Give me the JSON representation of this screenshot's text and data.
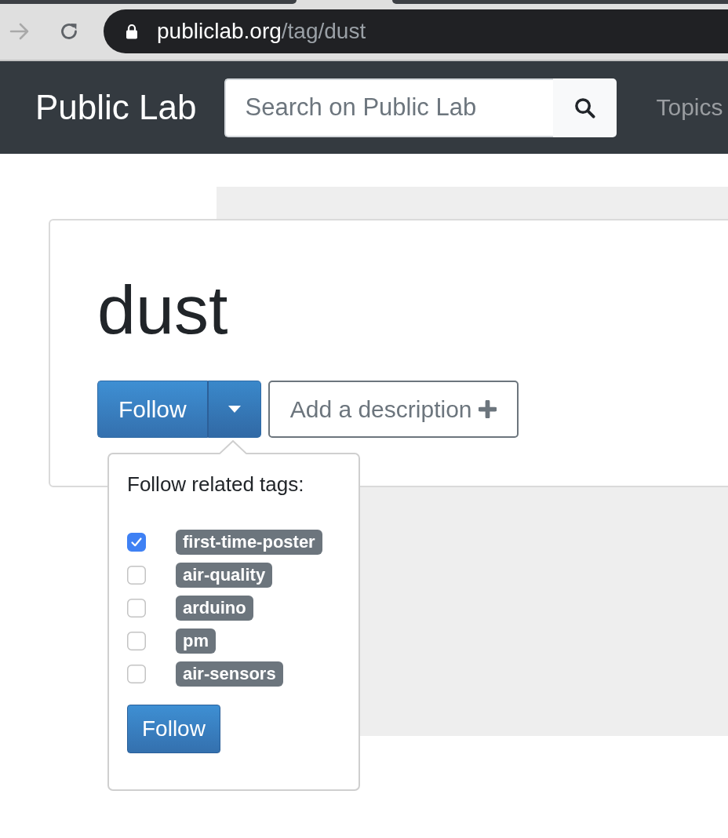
{
  "browser": {
    "url": {
      "host": "publiclab.org",
      "path": "/tag/dust"
    }
  },
  "navbar": {
    "brand": "Public Lab",
    "search": {
      "placeholder": "Search on Public Lab"
    },
    "links": [
      {
        "label": "Topics"
      }
    ]
  },
  "tag_header": {
    "title": "dust",
    "follow_button": {
      "label": "Follow",
      "expanded": true
    },
    "description_button": {
      "label": "Add a description"
    }
  },
  "follow_menu": {
    "heading": "Follow related tags:",
    "tags": [
      {
        "label": "first-time-poster",
        "checked": true
      },
      {
        "label": "air-quality",
        "checked": false
      },
      {
        "label": "arduino",
        "checked": false
      },
      {
        "label": "pm",
        "checked": false
      },
      {
        "label": "air-sensors",
        "checked": false
      }
    ],
    "button": "Follow"
  }
}
